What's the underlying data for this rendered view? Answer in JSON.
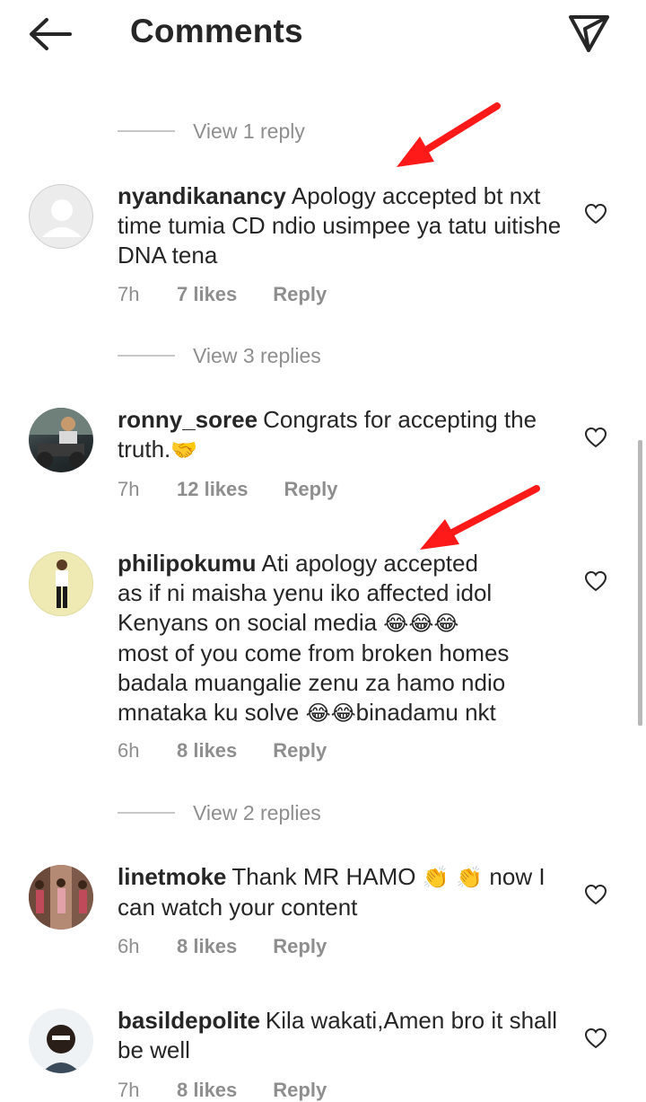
{
  "header": {
    "title": "Comments"
  },
  "view_replies": [
    "View 1 reply",
    "View 3 replies",
    "View 2 replies"
  ],
  "comments": [
    {
      "user": "nyandikanancy",
      "text": "Apology accepted bt nxt time tumia CD ndio usimpee ya tatu uitishe DNA tena",
      "time": "7h",
      "likes": "7 likes",
      "reply": "Reply"
    },
    {
      "user": "ronny_soree",
      "text": "Congrats for accepting the truth.",
      "emoji": "🤝",
      "time": "7h",
      "likes": "12 likes",
      "reply": "Reply"
    },
    {
      "user": "philipokumu",
      "text_1": "Ati apology accepted",
      "text_2": "as if ni maisha yenu iko affected idol",
      "text_3": "Kenyans on social media",
      "emoji_3": "😂😂😂",
      "text_4": "most of you come from broken homes",
      "text_5": "badala muangalie zenu za hamo ndio",
      "text_6a": "mnataka ku solve",
      "emoji_6": "😂😂",
      "text_6b": "binadamu nkt",
      "time": "6h",
      "likes": "8 likes",
      "reply": "Reply"
    },
    {
      "user": "linetmoke",
      "text_a": "Thank MR HAMO",
      "emoji": "👏 👏",
      "text_b": "now I can watch your content",
      "time": "6h",
      "likes": "8 likes",
      "reply": "Reply"
    },
    {
      "user": "basildepolite",
      "text": "Kila wakati,Amen bro it shall be well",
      "time": "7h",
      "likes": "8 likes",
      "reply": "Reply"
    }
  ],
  "icons": {
    "back": "back-arrow-icon",
    "send": "send-icon",
    "heart": "heart-outline-icon"
  },
  "colors": {
    "annotation_arrow": "#ff1a1a",
    "muted_text": "#8e8e8e"
  }
}
